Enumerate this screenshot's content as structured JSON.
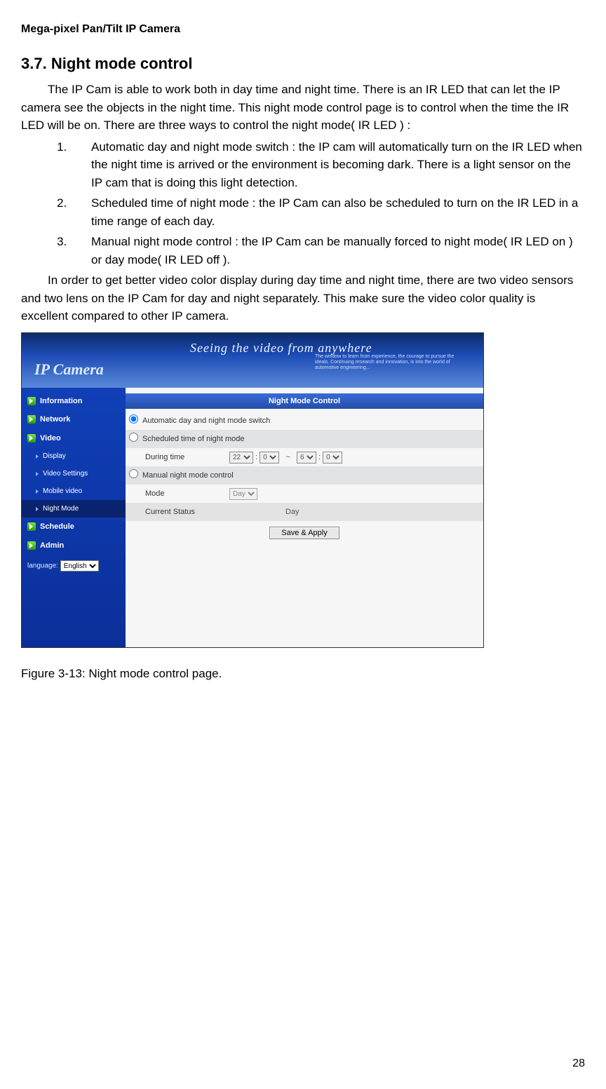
{
  "doc": {
    "header": "Mega-pixel Pan/Tilt IP Camera",
    "section_number": "3.7.",
    "section_title": "Night mode control",
    "para1": "The IP Cam is able to work both in day time and night time. There is an IR LED that can let the IP camera see the objects in the night time. This night mode control page is to control when the time the IR LED will be on. There are three ways to control the night mode( IR LED ) :",
    "list": [
      "Automatic day and night mode switch : the IP cam will automatically turn on the IR LED when the night time is arrived or the environment is becoming dark. There is a light sensor on the IP cam that is doing this light detection.",
      "Scheduled time of night mode : the IP Cam can also be scheduled to turn on the IR LED in a time range of each day.",
      "Manual night mode control : the IP Cam can be manually forced to night mode( IR LED on ) or day mode( IR LED off )."
    ],
    "para2": "In order to get better video color display during day time and night time, there are two video sensors and two lens on the IP Cam for day and night separately. This make sure the video color quality is excellent compared to other IP camera.",
    "caption": "Figure 3-13: Night mode control page.",
    "page_number": "28"
  },
  "screenshot": {
    "banner_title": "IP Camera",
    "banner_tag": "Seeing the video from anywhere",
    "sidebar": {
      "items_top": [
        "Information",
        "Network",
        "Video"
      ],
      "subs": [
        "Display",
        "Video Settings",
        "Mobile video",
        "Night Mode"
      ],
      "items_bottom": [
        "Schedule",
        "Admin"
      ],
      "lang_label": "language:",
      "lang_value": "English"
    },
    "panel": {
      "title": "Night Mode Control",
      "opt_auto": "Automatic day and night mode switch",
      "opt_sched": "Scheduled time of night mode",
      "during_label": "During time",
      "h1": "22",
      "m1": "0",
      "sep": "~",
      "h2": "6",
      "m2": "0",
      "opt_manual": "Manual night mode control",
      "mode_label": "Mode",
      "mode_value": "Day",
      "status_label": "Current Status",
      "status_value": "Day",
      "save_btn": "Save & Apply"
    }
  }
}
